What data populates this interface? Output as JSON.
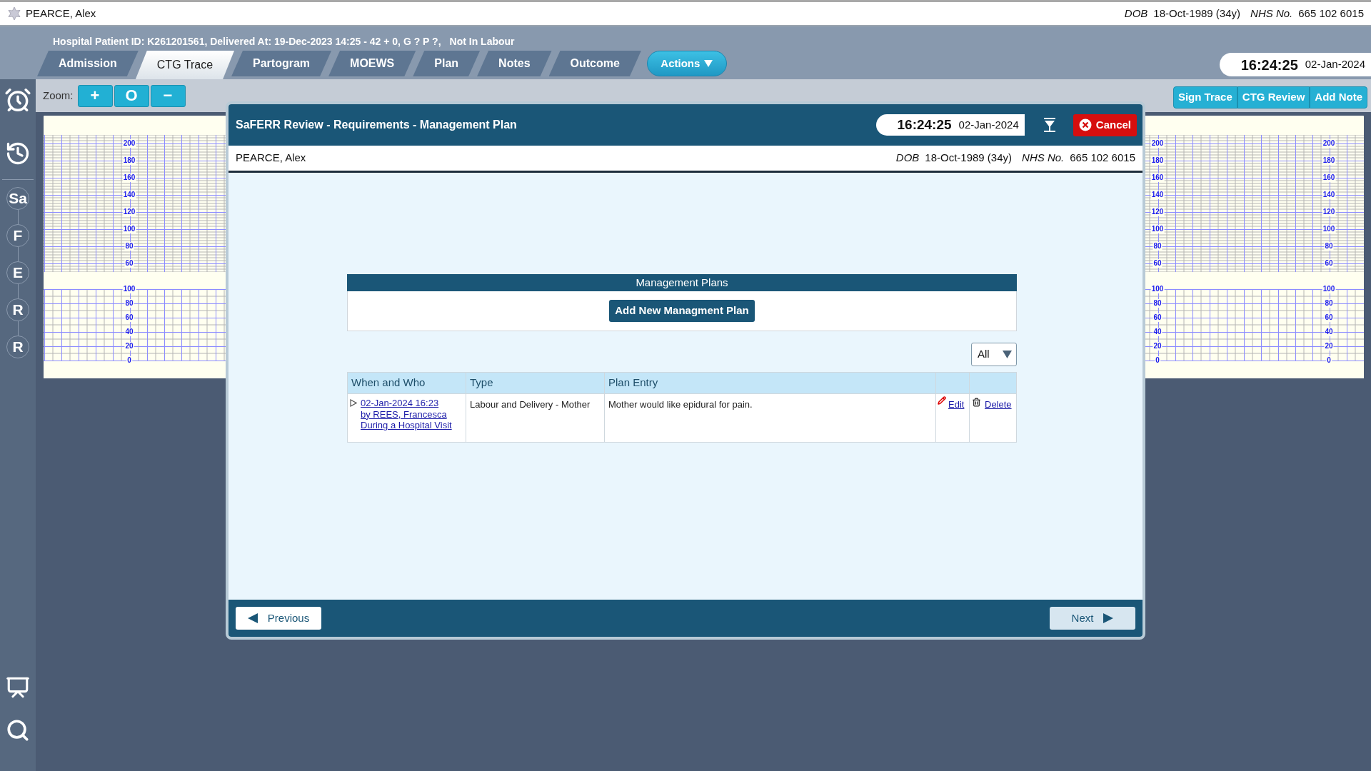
{
  "patient_bar": {
    "name": "PEARCE, Alex",
    "dob_label": "DOB",
    "dob": "18-Oct-1989 (34y)",
    "nhs_label": "NHS No.",
    "nhs": "665 102 6015"
  },
  "info_line": "Hospital Patient ID: K261201561, Delivered At: 19-Dec-2023 14:25 - 42 + 0, G ? P ?,",
  "labour_status": "Not In Labour",
  "tabs": [
    {
      "label": "Admission",
      "selected": false
    },
    {
      "label": "CTG Trace",
      "selected": true
    },
    {
      "label": "Partogram",
      "selected": false
    },
    {
      "label": "MOEWS",
      "selected": false
    },
    {
      "label": "Plan",
      "selected": false
    },
    {
      "label": "Notes",
      "selected": false
    },
    {
      "label": "Outcome",
      "selected": false
    }
  ],
  "actions_button": "Actions",
  "clock": {
    "time": "16:24:25",
    "date": "02-Jan-2024"
  },
  "zoom": {
    "label": "Zoom:",
    "buttons": [
      "+",
      "O",
      "−"
    ]
  },
  "trace_buttons": [
    "Sign Trace",
    "CTG Review",
    "Add Note"
  ],
  "sidebar": {
    "letters": [
      "Sa",
      "F",
      "E",
      "R",
      "R"
    ]
  },
  "ctg": {
    "scales": [
      {
        "fhr": [
          "200",
          "180",
          "160",
          "140",
          "120",
          "100",
          "80",
          "60"
        ],
        "toco": [
          "100",
          "80",
          "60",
          "40",
          "20",
          "0"
        ]
      },
      {
        "fhr": [
          "200",
          "180",
          "160",
          "140",
          "120",
          "100",
          "80",
          "60"
        ],
        "toco": [
          "100",
          "80",
          "60",
          "40",
          "20",
          "0"
        ]
      },
      {
        "fhr": [
          "200",
          "180",
          "160",
          "140",
          "120",
          "100",
          "80",
          "60"
        ],
        "toco": [
          "100",
          "80",
          "60",
          "40",
          "20",
          "0"
        ]
      }
    ]
  },
  "modal": {
    "title": "SaFERR Review - Requirements - Management Plan",
    "clock": {
      "time": "16:24:25",
      "date": "02-Jan-2024"
    },
    "cancel": "Cancel",
    "patient": {
      "name": "PEARCE, Alex",
      "dob_label": "DOB",
      "dob": "18-Oct-1989 (34y)",
      "nhs_label": "NHS No.",
      "nhs": "665 102 6015"
    },
    "section_title": "Management Plans",
    "add_button": "Add New Managment Plan",
    "filter": "All",
    "table": {
      "columns": [
        "When and Who",
        "Type",
        "Plan Entry"
      ],
      "rows": [
        {
          "expanded": false,
          "when": "02-Jan-2024 16:23",
          "who": "by REES, Francesca",
          "context": "During a Hospital Visit",
          "type": "Labour and Delivery - Mother",
          "entry": "Mother would like epidural for pain.",
          "edit": "Edit",
          "delete": "Delete"
        }
      ]
    },
    "previous": "Previous",
    "next": "Next"
  }
}
